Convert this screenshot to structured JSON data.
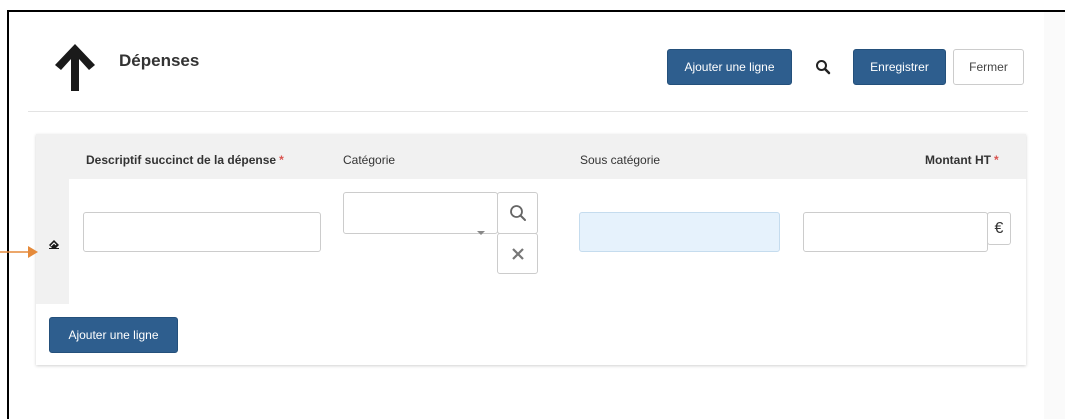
{
  "header": {
    "title": "Dépenses",
    "buttons": {
      "add_line": "Ajouter une ligne",
      "save": "Enregistrer",
      "close": "Fermer"
    }
  },
  "table": {
    "columns": [
      {
        "label": "Descriptif succinct de la dépense",
        "required_marker": "*"
      },
      {
        "label": "Catégorie"
      },
      {
        "label": "Sous catégorie"
      },
      {
        "label": "Montant HT",
        "required_marker": "*"
      }
    ],
    "row": {
      "description_value": "",
      "category_value": "",
      "subcategory_value": "",
      "amount_value": "",
      "currency_symbol": "€"
    },
    "add_line_label": "Ajouter une ligne"
  },
  "colors": {
    "primary": "#2e5e8e",
    "required": "#d9534f",
    "readonly_field": "#e6f2fc",
    "annotation_arrow": "#e58a3a"
  },
  "icons": [
    "arrow-up-icon",
    "search-icon",
    "clear-icon",
    "eraser-icon",
    "pointer-arrow-icon"
  ]
}
